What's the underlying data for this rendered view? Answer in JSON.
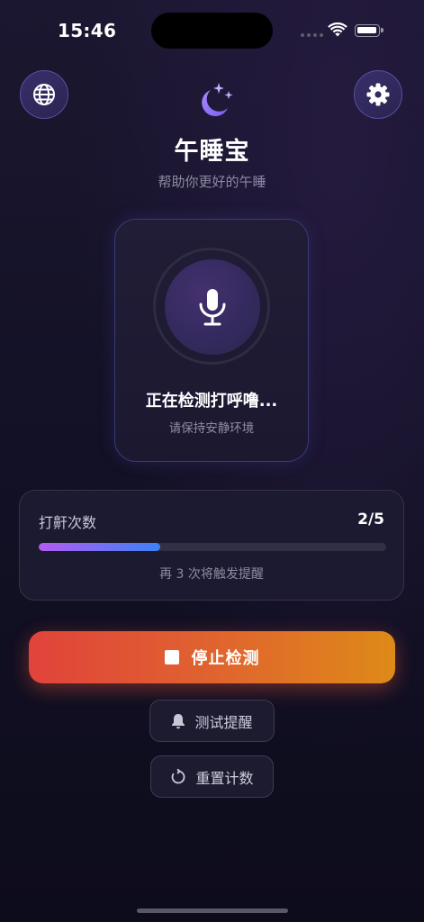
{
  "status_bar": {
    "time": "15:46"
  },
  "header": {
    "title": "午睡宝",
    "subtitle": "帮助你更好的午睡",
    "left_icon": "globe-icon",
    "right_icon": "gear-icon",
    "logo_icon": "moon-stars-icon"
  },
  "detection": {
    "icon": "microphone-icon",
    "status": "正在检测打呼噜...",
    "hint": "请保持安静环境"
  },
  "snore_counter": {
    "label": "打鼾次数",
    "value": "2/5",
    "progress": 0.35,
    "note": "再 3 次将触发提醒"
  },
  "actions": {
    "stop_label": "停止检测",
    "test_label": "测试提醒",
    "reset_label": "重置计数"
  },
  "colors": {
    "accent_purple": "#8b6cf0",
    "progress_start": "#b35cf0",
    "progress_end": "#3b82f6",
    "stop_start": "#e0433a",
    "stop_end": "#de8a18"
  }
}
